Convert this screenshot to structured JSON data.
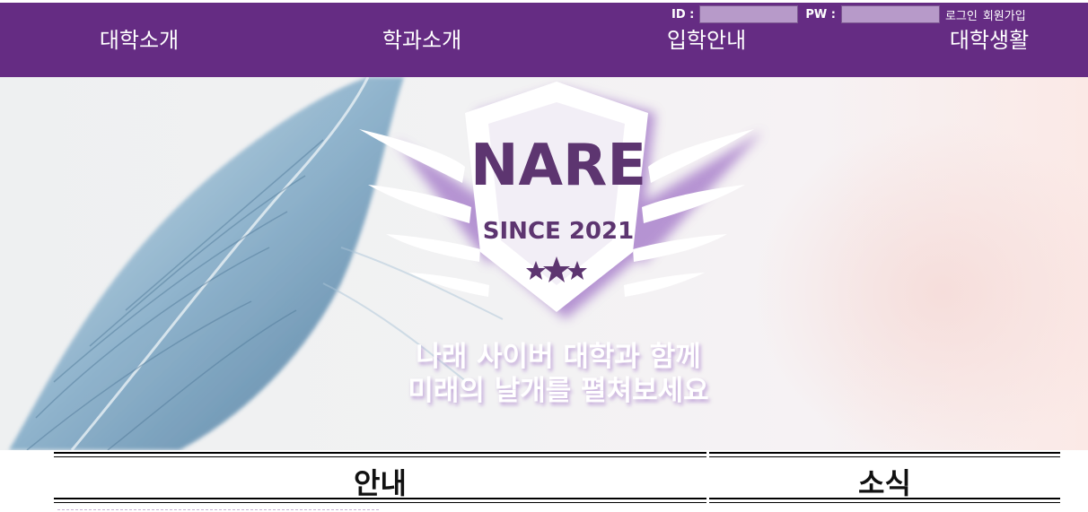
{
  "login": {
    "id_label": "ID :",
    "pw_label": "PW :",
    "login_link": "로그인",
    "signup_link": "회원가입",
    "id_value": "",
    "pw_value": ""
  },
  "nav": {
    "items": [
      {
        "label": "대학소개"
      },
      {
        "label": "학과소개"
      },
      {
        "label": "입학안내"
      },
      {
        "label": "대학생활"
      }
    ]
  },
  "hero": {
    "logo_title": "NARE",
    "logo_since": "SINCE 2021",
    "tagline_line1": "나래 사이버 대학과 함께",
    "tagline_line2": "미래의 날개를 펼쳐보세요"
  },
  "sections": [
    {
      "title": "안내"
    },
    {
      "title": "소식"
    }
  ],
  "colors": {
    "header": "#652c83",
    "input_bg": "#b79ac9",
    "logo_shadow": "#9b6cc4"
  }
}
